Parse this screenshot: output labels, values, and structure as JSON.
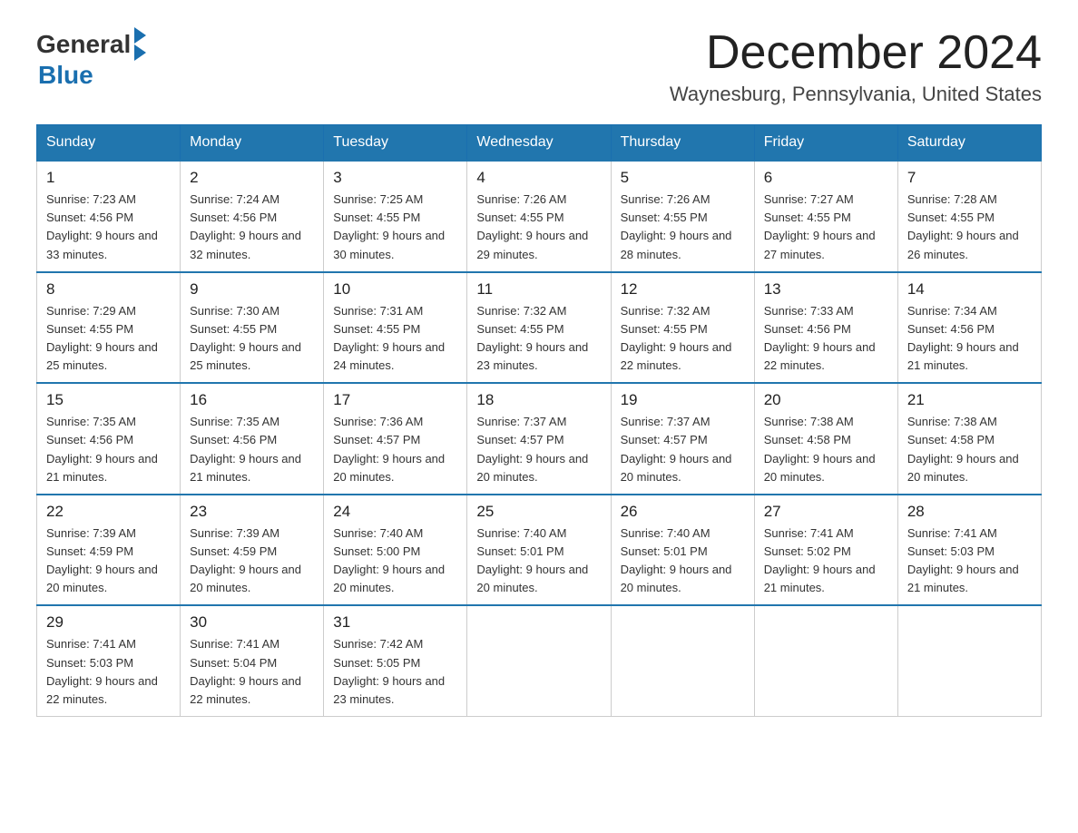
{
  "header": {
    "logo_general": "General",
    "logo_blue": "Blue",
    "month_title": "December 2024",
    "location": "Waynesburg, Pennsylvania, United States"
  },
  "days_of_week": [
    "Sunday",
    "Monday",
    "Tuesday",
    "Wednesday",
    "Thursday",
    "Friday",
    "Saturday"
  ],
  "weeks": [
    [
      {
        "day": "1",
        "sunrise": "7:23 AM",
        "sunset": "4:56 PM",
        "daylight": "9 hours and 33 minutes."
      },
      {
        "day": "2",
        "sunrise": "7:24 AM",
        "sunset": "4:56 PM",
        "daylight": "9 hours and 32 minutes."
      },
      {
        "day": "3",
        "sunrise": "7:25 AM",
        "sunset": "4:55 PM",
        "daylight": "9 hours and 30 minutes."
      },
      {
        "day": "4",
        "sunrise": "7:26 AM",
        "sunset": "4:55 PM",
        "daylight": "9 hours and 29 minutes."
      },
      {
        "day": "5",
        "sunrise": "7:26 AM",
        "sunset": "4:55 PM",
        "daylight": "9 hours and 28 minutes."
      },
      {
        "day": "6",
        "sunrise": "7:27 AM",
        "sunset": "4:55 PM",
        "daylight": "9 hours and 27 minutes."
      },
      {
        "day": "7",
        "sunrise": "7:28 AM",
        "sunset": "4:55 PM",
        "daylight": "9 hours and 26 minutes."
      }
    ],
    [
      {
        "day": "8",
        "sunrise": "7:29 AM",
        "sunset": "4:55 PM",
        "daylight": "9 hours and 25 minutes."
      },
      {
        "day": "9",
        "sunrise": "7:30 AM",
        "sunset": "4:55 PM",
        "daylight": "9 hours and 25 minutes."
      },
      {
        "day": "10",
        "sunrise": "7:31 AM",
        "sunset": "4:55 PM",
        "daylight": "9 hours and 24 minutes."
      },
      {
        "day": "11",
        "sunrise": "7:32 AM",
        "sunset": "4:55 PM",
        "daylight": "9 hours and 23 minutes."
      },
      {
        "day": "12",
        "sunrise": "7:32 AM",
        "sunset": "4:55 PM",
        "daylight": "9 hours and 22 minutes."
      },
      {
        "day": "13",
        "sunrise": "7:33 AM",
        "sunset": "4:56 PM",
        "daylight": "9 hours and 22 minutes."
      },
      {
        "day": "14",
        "sunrise": "7:34 AM",
        "sunset": "4:56 PM",
        "daylight": "9 hours and 21 minutes."
      }
    ],
    [
      {
        "day": "15",
        "sunrise": "7:35 AM",
        "sunset": "4:56 PM",
        "daylight": "9 hours and 21 minutes."
      },
      {
        "day": "16",
        "sunrise": "7:35 AM",
        "sunset": "4:56 PM",
        "daylight": "9 hours and 21 minutes."
      },
      {
        "day": "17",
        "sunrise": "7:36 AM",
        "sunset": "4:57 PM",
        "daylight": "9 hours and 20 minutes."
      },
      {
        "day": "18",
        "sunrise": "7:37 AM",
        "sunset": "4:57 PM",
        "daylight": "9 hours and 20 minutes."
      },
      {
        "day": "19",
        "sunrise": "7:37 AM",
        "sunset": "4:57 PM",
        "daylight": "9 hours and 20 minutes."
      },
      {
        "day": "20",
        "sunrise": "7:38 AM",
        "sunset": "4:58 PM",
        "daylight": "9 hours and 20 minutes."
      },
      {
        "day": "21",
        "sunrise": "7:38 AM",
        "sunset": "4:58 PM",
        "daylight": "9 hours and 20 minutes."
      }
    ],
    [
      {
        "day": "22",
        "sunrise": "7:39 AM",
        "sunset": "4:59 PM",
        "daylight": "9 hours and 20 minutes."
      },
      {
        "day": "23",
        "sunrise": "7:39 AM",
        "sunset": "4:59 PM",
        "daylight": "9 hours and 20 minutes."
      },
      {
        "day": "24",
        "sunrise": "7:40 AM",
        "sunset": "5:00 PM",
        "daylight": "9 hours and 20 minutes."
      },
      {
        "day": "25",
        "sunrise": "7:40 AM",
        "sunset": "5:01 PM",
        "daylight": "9 hours and 20 minutes."
      },
      {
        "day": "26",
        "sunrise": "7:40 AM",
        "sunset": "5:01 PM",
        "daylight": "9 hours and 20 minutes."
      },
      {
        "day": "27",
        "sunrise": "7:41 AM",
        "sunset": "5:02 PM",
        "daylight": "9 hours and 21 minutes."
      },
      {
        "day": "28",
        "sunrise": "7:41 AM",
        "sunset": "5:03 PM",
        "daylight": "9 hours and 21 minutes."
      }
    ],
    [
      {
        "day": "29",
        "sunrise": "7:41 AM",
        "sunset": "5:03 PM",
        "daylight": "9 hours and 22 minutes."
      },
      {
        "day": "30",
        "sunrise": "7:41 AM",
        "sunset": "5:04 PM",
        "daylight": "9 hours and 22 minutes."
      },
      {
        "day": "31",
        "sunrise": "7:42 AM",
        "sunset": "5:05 PM",
        "daylight": "9 hours and 23 minutes."
      },
      null,
      null,
      null,
      null
    ]
  ]
}
